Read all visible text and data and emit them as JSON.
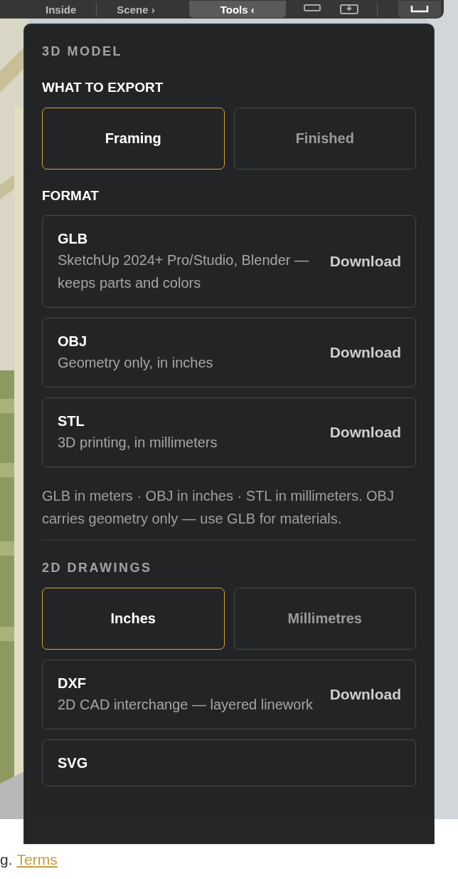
{
  "toolbar": {
    "items": [
      {
        "label": "Inside",
        "kind": "text",
        "selected": false
      },
      {
        "label": "Scene ›",
        "kind": "text",
        "selected": false
      },
      {
        "label": "Tools ‹",
        "kind": "text",
        "selected": true
      }
    ]
  },
  "panel": {
    "section_title": "3D MODEL",
    "export_label": "WHAT TO EXPORT",
    "export_options": [
      {
        "label": "Framing",
        "selected": true
      },
      {
        "label": "Finished",
        "selected": false
      }
    ],
    "format_label": "FORMAT",
    "formats": [
      {
        "name": "GLB",
        "description": "SketchUp 2024+ Pro/Studio, Blender — keeps parts and colors",
        "action": "Download"
      },
      {
        "name": "OBJ",
        "description": "Geometry only, in inches",
        "action": "Download"
      },
      {
        "name": "STL",
        "description": "3D printing, in millimeters",
        "action": "Download"
      }
    ],
    "note": "GLB in meters · OBJ in inches · STL in millimeters. OBJ carries geometry only — use GLB for materials.",
    "drawings_title": "2D DRAWINGS",
    "unit_options": [
      {
        "label": "Inches",
        "selected": true
      },
      {
        "label": "Millimetres",
        "selected": false
      }
    ],
    "drawing_formats": [
      {
        "name": "DXF",
        "description": "2D CAD interchange — layered linework",
        "action": "Download"
      },
      {
        "name": "SVG"
      }
    ]
  },
  "footer": {
    "text": "g.",
    "link": "Terms"
  }
}
